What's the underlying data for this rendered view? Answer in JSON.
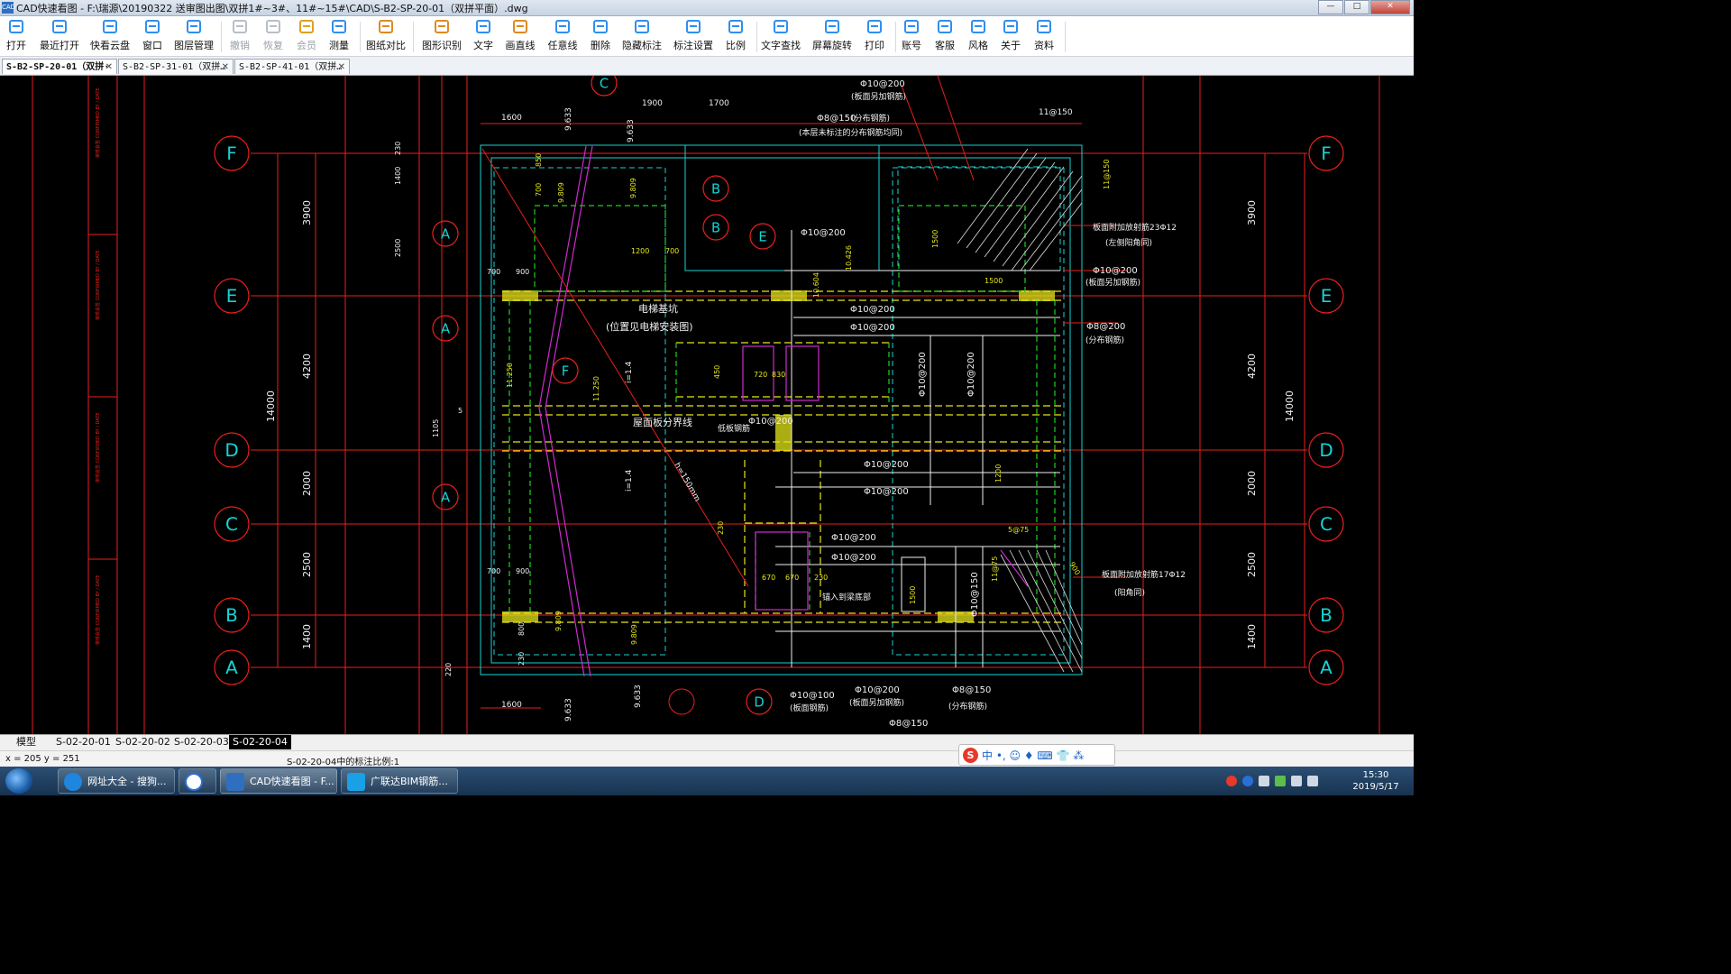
{
  "window": {
    "title": "CAD快速看图 - F:\\瑞源\\20190322 送审图出图\\双拼1#~3#、11#~15#\\CAD\\S-B2-SP-20-01（双拼平面）.dwg",
    "app_icon_text": "CAD",
    "buttons": [
      "—",
      "□",
      "✕"
    ]
  },
  "toolbar": {
    "items": [
      {
        "label": "打开",
        "icon": "folder-open-icon",
        "enabled": true
      },
      {
        "label": "最近打开",
        "icon": "history-icon",
        "enabled": true
      },
      {
        "label": "快看云盘",
        "icon": "cloud-icon",
        "enabled": true
      },
      {
        "label": "窗口",
        "icon": "window-icon",
        "enabled": true
      },
      {
        "label": "图层管理",
        "icon": "layers-icon",
        "enabled": true
      },
      {
        "label": "撤销",
        "icon": "undo-icon",
        "enabled": false
      },
      {
        "label": "恢复",
        "icon": "redo-icon",
        "enabled": false
      },
      {
        "label": "会员",
        "icon": "vip-icon",
        "enabled": false
      },
      {
        "label": "测量",
        "icon": "ruler-icon",
        "enabled": true
      },
      {
        "label": "图纸对比",
        "icon": "compare-icon",
        "enabled": true
      },
      {
        "label": "图形识别",
        "icon": "shape-recognize-icon",
        "enabled": true
      },
      {
        "label": "文字",
        "icon": "text-icon",
        "enabled": true
      },
      {
        "label": "画直线",
        "icon": "line-icon",
        "enabled": true
      },
      {
        "label": "任意线",
        "icon": "pen-icon",
        "enabled": true
      },
      {
        "label": "删除",
        "icon": "eraser-icon",
        "enabled": true
      },
      {
        "label": "隐藏标注",
        "icon": "hide-icon",
        "enabled": true
      },
      {
        "label": "标注设置",
        "icon": "annotation-settings-icon",
        "enabled": true
      },
      {
        "label": "比例",
        "icon": "scale-icon",
        "enabled": true
      },
      {
        "label": "文字查找",
        "icon": "text-search-icon",
        "enabled": true
      },
      {
        "label": "屏幕旋转",
        "icon": "rotate-icon",
        "enabled": true
      },
      {
        "label": "打印",
        "icon": "printer-icon",
        "enabled": true
      },
      {
        "label": "账号",
        "icon": "user-icon",
        "enabled": true
      },
      {
        "label": "客服",
        "icon": "headset-icon",
        "enabled": true
      },
      {
        "label": "风格",
        "icon": "style-icon",
        "enabled": true
      },
      {
        "label": "关于",
        "icon": "info-icon",
        "enabled": true
      },
      {
        "label": "资料",
        "icon": "docs-icon",
        "enabled": true
      }
    ]
  },
  "file_tabs": [
    {
      "label": "S-B2-SP-20-01（双拼·",
      "active": true
    },
    {
      "label": "S-B2-SP-31-01（双拼…",
      "active": false
    },
    {
      "label": "S-B2-SP-41-01（双拼…",
      "active": false
    }
  ],
  "drawing": {
    "grid_axes_left": [
      "F",
      "E",
      "D",
      "C",
      "B",
      "A"
    ],
    "grid_axes_right": [
      "F",
      "E",
      "D",
      "C",
      "B",
      "A"
    ],
    "dims_left": [
      "3900",
      "4200",
      "2000",
      "2500",
      "1400"
    ],
    "dims_right": [
      "3900",
      "4200",
      "2000",
      "2500",
      "1400"
    ],
    "total_dim": "14000",
    "dims_misc": [
      "230",
      "1400",
      "2500",
      "1105",
      "5",
      "700",
      "900",
      "220",
      "800",
      "230"
    ],
    "top_dims": [
      "1600",
      "9.633",
      "1900",
      "1700",
      "9.633",
      "11@150"
    ],
    "inner_dims": [
      "850",
      "9.809",
      "700",
      "1200",
      "700",
      "10.426",
      "10.604",
      "11.250",
      "11.250",
      "720",
      "830",
      "450",
      "670",
      "670",
      "230",
      "230",
      "5@75",
      "900",
      "1500",
      "1500",
      "1200",
      "1500",
      "11@150",
      "11@75",
      "9.809",
      "9.809"
    ],
    "section_bubbles": [
      "B",
      "A",
      "B",
      "A",
      "E",
      "F",
      "A",
      "C",
      "D"
    ],
    "rebar_labels": [
      "Φ10@200",
      "Φ10@200",
      "Φ10@200",
      "Φ10@200",
      "Φ10@200",
      "Φ10@200",
      "Φ10@200",
      "Φ10@200",
      "Φ10@200",
      "Φ10@150",
      "Φ10@200",
      "Φ10@200",
      "Φ8@150",
      "Φ8@200",
      "Φ10@100",
      "Φ8@150",
      "Φ10@200",
      "Φ8@150",
      "Φ8@200"
    ],
    "notes": [
      "(板面另加钢筋)",
      "(分布钢筋)",
      "(本层未标注的分布钢筋均同)",
      "电梯基坑",
      "(位置见电梯安装图)",
      "i=1.4",
      "i=1.4",
      "屋面板分界线",
      "h=150mm",
      "低板钢筋",
      "板面附加放射筋23Φ12",
      "(左侧阳角同)",
      "板面附加放射筋17Φ12",
      "(阳角同)",
      "(板面另加钢筋)",
      "(分布钢筋)",
      "(板面钢筋)",
      "(板面另加钢筋)",
      "(分布钢筋)",
      "锚入到梁底部"
    ],
    "side_stamps": [
      "审核会签 CONFIRMED BY / DATE",
      "审核会签 CONFIRMED BY / DATE",
      "审核会签 CONFIRMED BY / DATE",
      "审核会签 CONFIRMED BY / DATE"
    ]
  },
  "layout_tabs": [
    {
      "label": "模型",
      "active": false
    },
    {
      "label": "S-02-20-01",
      "active": false
    },
    {
      "label": "S-02-20-02",
      "active": false
    },
    {
      "label": "S-02-20-03",
      "active": false
    },
    {
      "label": "S-02-20-04",
      "active": true
    }
  ],
  "status": {
    "coords": "x = 205  y = 251",
    "scale_note": "S-02-20-04中的标注比例:1",
    "ime_text": "中 •, ☺ ♦ ⌨ 👕 ⁂"
  },
  "taskbar": {
    "items": [
      {
        "label": "网址大全 - 搜狗...",
        "active": false
      },
      {
        "label": "",
        "active": false
      },
      {
        "label": "CAD快速看图 - F...",
        "active": true
      },
      {
        "label": "广联达BIM钢筋...",
        "active": false
      }
    ],
    "time": "15:30",
    "date": "2019/5/17"
  },
  "colors": {
    "canvas_bg": "#000000",
    "axis_red": "#e8201c",
    "cyan": "#16d4d4",
    "yellow": "#e6e61a",
    "green": "#1fd11f",
    "magenta": "#d02ad0",
    "white": "#f0f0f0"
  }
}
